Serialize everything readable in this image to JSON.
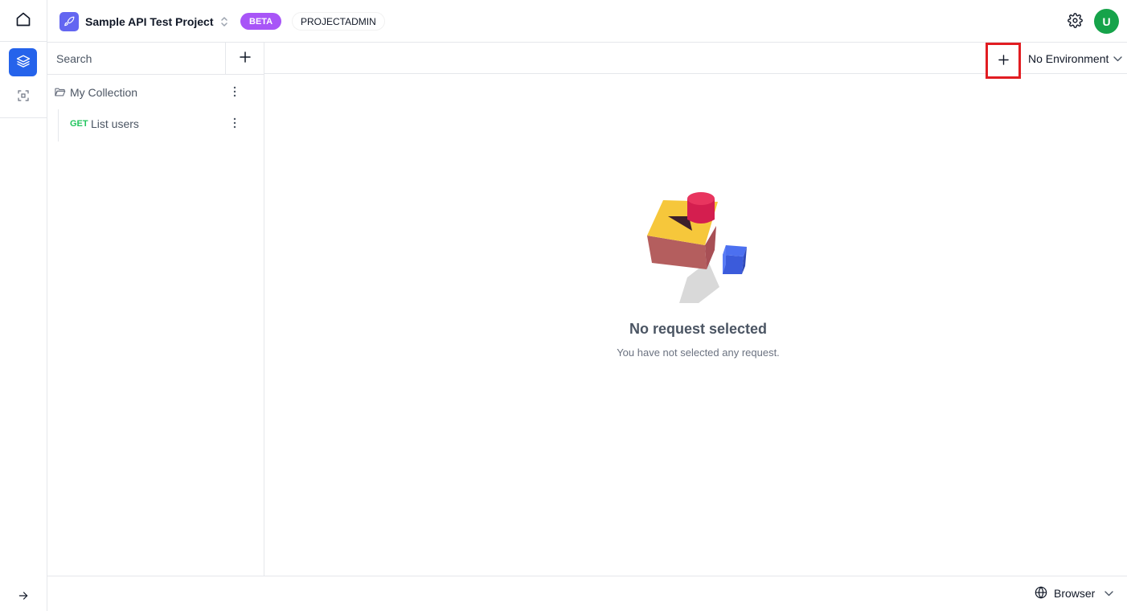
{
  "header": {
    "project_name": "Sample API Test Project",
    "beta_badge": "BETA",
    "role_badge": "PROJECTADMIN",
    "avatar_initial": "U"
  },
  "sidebar": {
    "search_placeholder": "Search",
    "collection": {
      "name": "My Collection",
      "requests": [
        {
          "method": "GET",
          "name": "List users"
        }
      ]
    }
  },
  "main": {
    "environment": "No Environment",
    "empty_title": "No request selected",
    "empty_subtitle": "You have not selected any request."
  },
  "footer": {
    "interceptor": "Browser"
  },
  "colors": {
    "accent": "#2563eb",
    "beta": "#a855f7",
    "avatar": "#16a34a",
    "get_method": "#22c55e",
    "highlight_box": "#e11d22"
  }
}
